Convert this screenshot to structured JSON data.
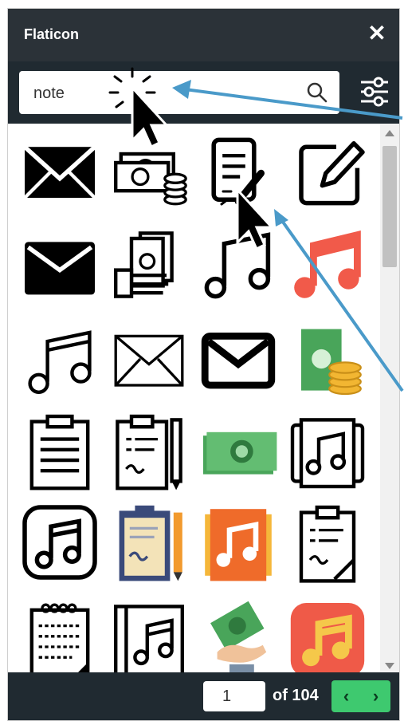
{
  "app": {
    "title": "Flaticon"
  },
  "search": {
    "value": "note"
  },
  "icons": [
    "envelope-icon",
    "money-coins-icon",
    "document-pen-icon",
    "edit-square-icon",
    "envelope-filled-icon",
    "hand-money-icon",
    "music-note-icon",
    "music-note-red-icon",
    "music-note-outline-icon",
    "envelope-outline-icon",
    "envelope-bold-icon",
    "money-coins-green-icon",
    "clipboard-icon",
    "clipboard-pen-icon",
    "banknote-green-icon",
    "music-album-icon",
    "music-app-icon",
    "clipboard-pencil-color-icon",
    "music-orange-icon",
    "clipboard-signed-icon",
    "notepad-spiral-icon",
    "music-book-icon",
    "money-hand-color-icon",
    "music-app-red-icon"
  ],
  "pagination": {
    "current": "1",
    "of_label": "of 104",
    "prev": "‹",
    "next": "›"
  },
  "colors": {
    "header": "#2b3238",
    "search_bar": "#202a31",
    "accent": "#3ec96f",
    "annotation_arrow": "#4a9ac9"
  }
}
